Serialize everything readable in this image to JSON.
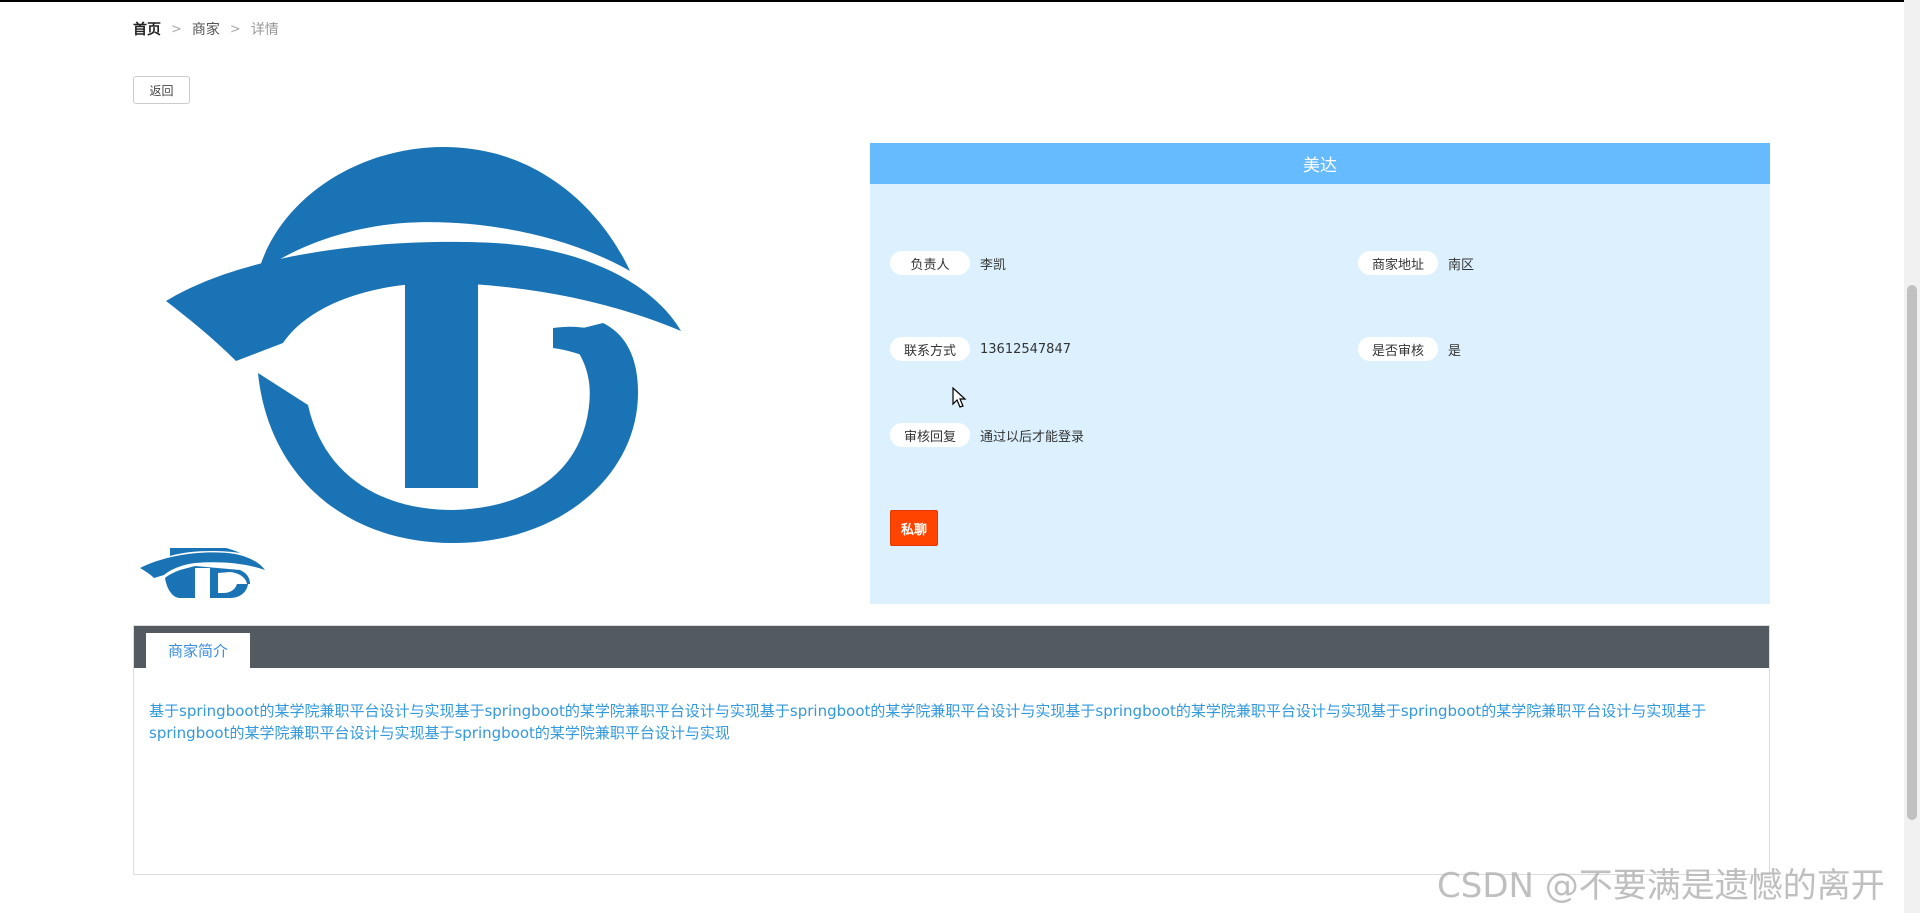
{
  "breadcrumb": {
    "home": "首页",
    "separator1": ">",
    "category": "商家",
    "separator2": ">",
    "current": "详情"
  },
  "back_label": "返回",
  "merchant": {
    "name": "美达",
    "fields": {
      "manager_label": "负责人",
      "manager_value": "李凯",
      "address_label": "商家地址",
      "address_value": "南区",
      "contact_label": "联系方式",
      "contact_value": "13612547847",
      "audit_label": "是否审核",
      "audit_value": "是",
      "reply_label": "审核回复",
      "reply_value": "通过以后才能登录"
    },
    "chat_label": "私聊"
  },
  "tabs": {
    "intro_label": "商家简介",
    "intro_text": "基于springboot的某学院兼职平台设计与实现基于springboot的某学院兼职平台设计与实现基于springboot的某学院兼职平台设计与实现基于springboot的某学院兼职平台设计与实现基于springboot的某学院兼职平台设计与实现基于springboot的某学院兼职平台设计与实现基于springboot的某学院兼职平台设计与实现"
  },
  "colors": {
    "title_bar": "#66bbff",
    "panel_bg": "#dcf1fd",
    "chat_button": "#ff4400",
    "tab_bar": "#535b60",
    "logo_blue": "#1a73b5"
  },
  "watermark": "CSDN @不要满是遗憾的离开"
}
